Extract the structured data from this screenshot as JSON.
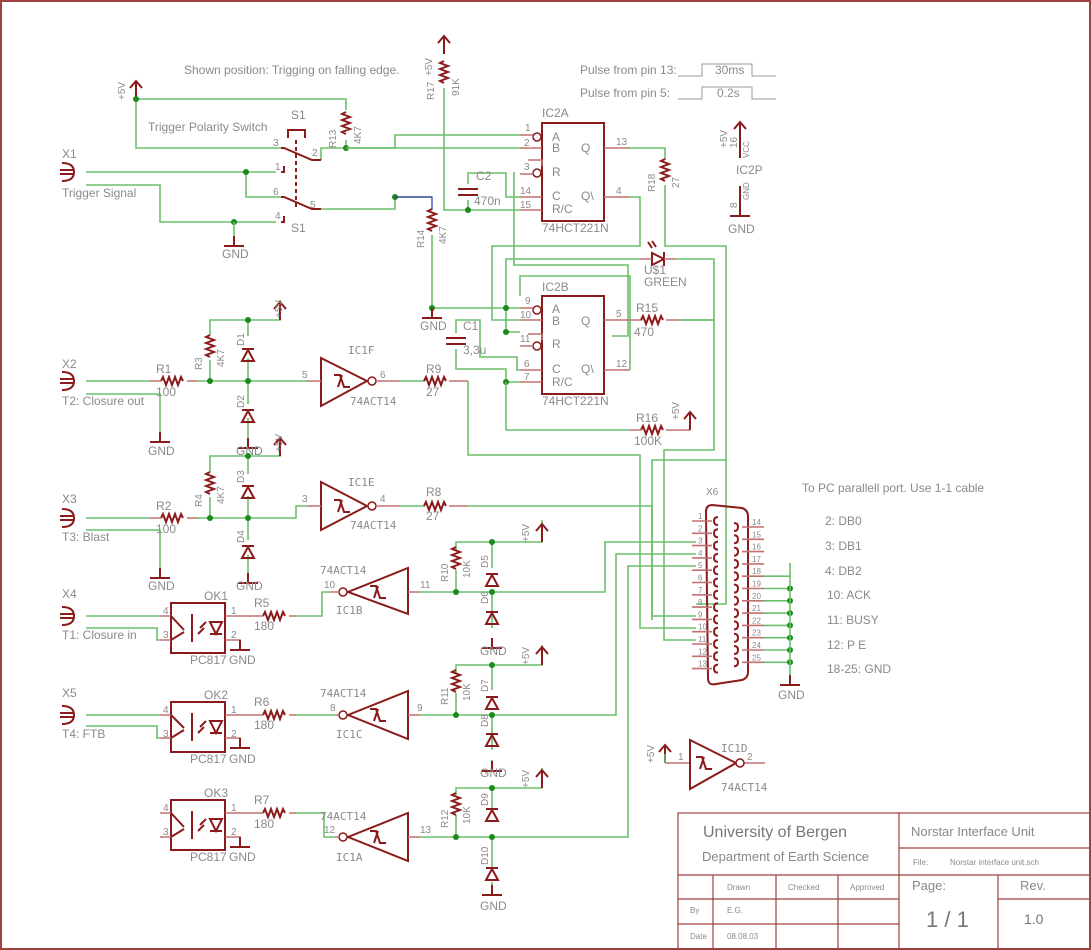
{
  "notes": {
    "shown_position": "Shown position: Trigging on falling edge.",
    "pulse13": "Pulse from pin 13:",
    "pulse13_width": "30ms",
    "pulse5": "Pulse from pin 5:",
    "pulse5_width": "0.2s",
    "trigger_switch": "Trigger Polarity Switch",
    "pc_port": "To PC parallell port. Use 1-1 cable",
    "pinmap": [
      "2: DB0",
      "3: DB1",
      "4: DB2",
      "10: ACK",
      "11: BUSY",
      "12: P E",
      "18-25: GND"
    ]
  },
  "nets": {
    "vcc": "+5V",
    "gnd": "GND"
  },
  "connectors": {
    "x1": {
      "name": "X1",
      "label": "Trigger Signal"
    },
    "x2": {
      "name": "X2",
      "label": "T2: Closure out"
    },
    "x3": {
      "name": "X3",
      "label": "T3: Blast"
    },
    "x4": {
      "name": "X4",
      "label": "T1: Closure in"
    },
    "x5": {
      "name": "X5",
      "label": "T4: FTB"
    },
    "x6": {
      "name": "X6",
      "left_pins": [
        "1",
        "2",
        "3",
        "4",
        "5",
        "6",
        "7",
        "8",
        "9",
        "10",
        "11",
        "12",
        "13"
      ],
      "right_pins": [
        "14",
        "15",
        "16",
        "17",
        "18",
        "19",
        "20",
        "21",
        "22",
        "23",
        "24",
        "25"
      ]
    }
  },
  "switch": {
    "name": "S1",
    "pins": [
      "3",
      "2",
      "1",
      "6",
      "5",
      "4"
    ]
  },
  "resistors": {
    "r1": {
      "name": "R1",
      "value": "100"
    },
    "r2": {
      "name": "R2",
      "value": "100"
    },
    "r3": {
      "name": "R3",
      "value": "4K7"
    },
    "r4": {
      "name": "R4",
      "value": "4K7"
    },
    "r5": {
      "name": "R5",
      "value": "180"
    },
    "r6": {
      "name": "R6",
      "value": "180"
    },
    "r7": {
      "name": "R7",
      "value": "180"
    },
    "r8": {
      "name": "R8",
      "value": "27"
    },
    "r9": {
      "name": "R9",
      "value": "27"
    },
    "r10": {
      "name": "R10",
      "value": "10K"
    },
    "r11": {
      "name": "R11",
      "value": "10K"
    },
    "r12": {
      "name": "R12",
      "value": "10K"
    },
    "r13": {
      "name": "R13",
      "value": "4K7"
    },
    "r14": {
      "name": "R14",
      "value": "4K7"
    },
    "r15": {
      "name": "R15",
      "value": "470"
    },
    "r16": {
      "name": "R16",
      "value": "100K"
    },
    "r17": {
      "name": "R17",
      "value": "91K"
    },
    "r18": {
      "name": "R18",
      "value": "27"
    }
  },
  "capacitors": {
    "c1": {
      "name": "C1",
      "value": "3,3u"
    },
    "c2": {
      "name": "C2",
      "value": "470n"
    }
  },
  "diodes": [
    "D1",
    "D2",
    "D3",
    "D4",
    "D5",
    "D6",
    "D7",
    "D8",
    "D9",
    "D10"
  ],
  "led": {
    "name": "U$1",
    "value": "GREEN"
  },
  "optos": {
    "ok1": {
      "name": "OK1",
      "part": "PC817"
    },
    "ok2": {
      "name": "OK2",
      "part": "PC817"
    },
    "ok3": {
      "name": "OK3",
      "part": "PC817"
    },
    "pins": [
      "4",
      "3",
      "1",
      "2"
    ]
  },
  "inverters": {
    "ic1f": {
      "name": "IC1F",
      "part": "74ACT14",
      "in": "5",
      "out": "6"
    },
    "ic1e": {
      "name": "IC1E",
      "part": "74ACT14",
      "in": "3",
      "out": "4"
    },
    "ic1b": {
      "name": "IC1B",
      "part": "74ACT14",
      "in": "11",
      "out": "10"
    },
    "ic1c": {
      "name": "IC1C",
      "part": "74ACT14",
      "in": "9",
      "out": "8"
    },
    "ic1a": {
      "name": "IC1A",
      "part": "74ACT14",
      "in": "13",
      "out": "12"
    },
    "ic1d": {
      "name": "IC1D",
      "part": "74ACT14",
      "in": "1",
      "out": "2"
    }
  },
  "monostables": {
    "ic2a": {
      "name": "IC2A",
      "part": "74HCT221N",
      "pins": {
        "a": "1",
        "b": "2",
        "r": "3",
        "c": "14",
        "rc": "15",
        "q": "13",
        "qn": "4"
      }
    },
    "ic2b": {
      "name": "IC2B",
      "part": "74HCT221N",
      "pins": {
        "a": "9",
        "b": "10",
        "r": "11",
        "c": "6",
        "rc": "7",
        "q": "5",
        "qn": "12"
      }
    },
    "pin_labels": {
      "a": "A",
      "b": "B",
      "r": "R",
      "c": "C",
      "rc": "R/C",
      "q": "Q",
      "qn": "Q\\"
    }
  },
  "power_block": {
    "name": "IC2P",
    "vcc_pin": "16",
    "vcc_label": "VCC",
    "gnd_pin": "8",
    "gnd_label": "GND"
  },
  "title_block": {
    "org": "University of Bergen",
    "dept": "Department of Earth Science",
    "title": "Norstar Interface Unit",
    "file_label": "File:",
    "file": "Norstar interface unit.sch",
    "col_drawn": "Drawn",
    "col_checked": "Checked",
    "col_approved": "Approved",
    "row_by": "By",
    "row_date": "Date",
    "drawn_by": "E.G.",
    "date": "08.08.03",
    "page_label": "Page:",
    "page": "1 / 1",
    "rev_label": "Rev.",
    "rev": "1.0"
  }
}
